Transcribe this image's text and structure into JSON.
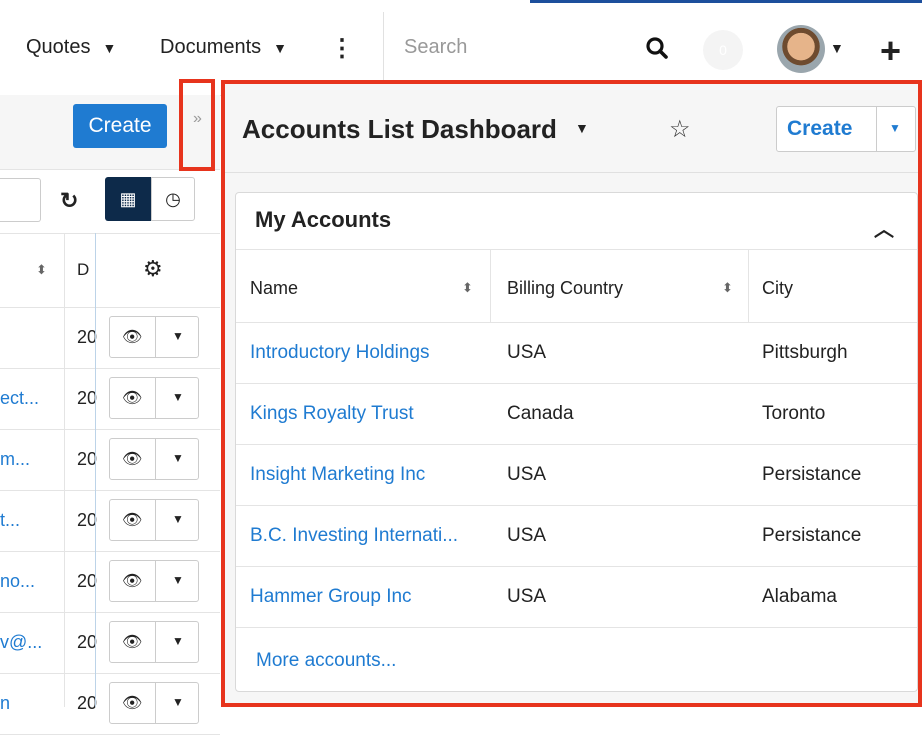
{
  "nav": {
    "items": [
      {
        "label": "Quotes"
      },
      {
        "label": "Documents"
      }
    ],
    "search_placeholder": "Search",
    "notification_count": "0"
  },
  "left": {
    "create_label": "Create",
    "collapse_glyph": "»",
    "header_col": "D",
    "rows": [
      {
        "name": "",
        "date": "20"
      },
      {
        "name": "ect...",
        "date": "20"
      },
      {
        "name": "m...",
        "date": "20"
      },
      {
        "name": "t...",
        "date": "20"
      },
      {
        "name": "no...",
        "date": "20"
      },
      {
        "name": "v@...",
        "date": "20"
      },
      {
        "name": "n",
        "date": "20"
      }
    ]
  },
  "dashboard": {
    "title": "Accounts List Dashboard",
    "create_label": "Create",
    "dashlet": {
      "title": "My Accounts",
      "columns": [
        "Name",
        "Billing Country",
        "City"
      ],
      "rows": [
        {
          "name": "Introductory Holdings",
          "country": "USA",
          "city": "Pittsburgh"
        },
        {
          "name": "Kings Royalty Trust",
          "country": "Canada",
          "city": "Toronto"
        },
        {
          "name": "Insight Marketing Inc",
          "country": "USA",
          "city": "Persistance"
        },
        {
          "name": "B.C. Investing Internati...",
          "country": "USA",
          "city": "Persistance"
        },
        {
          "name": "Hammer Group Inc",
          "country": "USA",
          "city": "Alabama"
        }
      ],
      "more_link": "More accounts..."
    }
  },
  "colors": {
    "accent": "#1f7bd1",
    "highlight": "#e7341d",
    "dark_button": "#0d2a4a"
  },
  "icons": [
    "more-vertical-icon",
    "search-icon",
    "avatar",
    "plus-icon",
    "refresh-icon",
    "grid-icon",
    "clock-icon",
    "gear-icon",
    "eye-icon",
    "star-icon",
    "chevron-up-icon"
  ]
}
